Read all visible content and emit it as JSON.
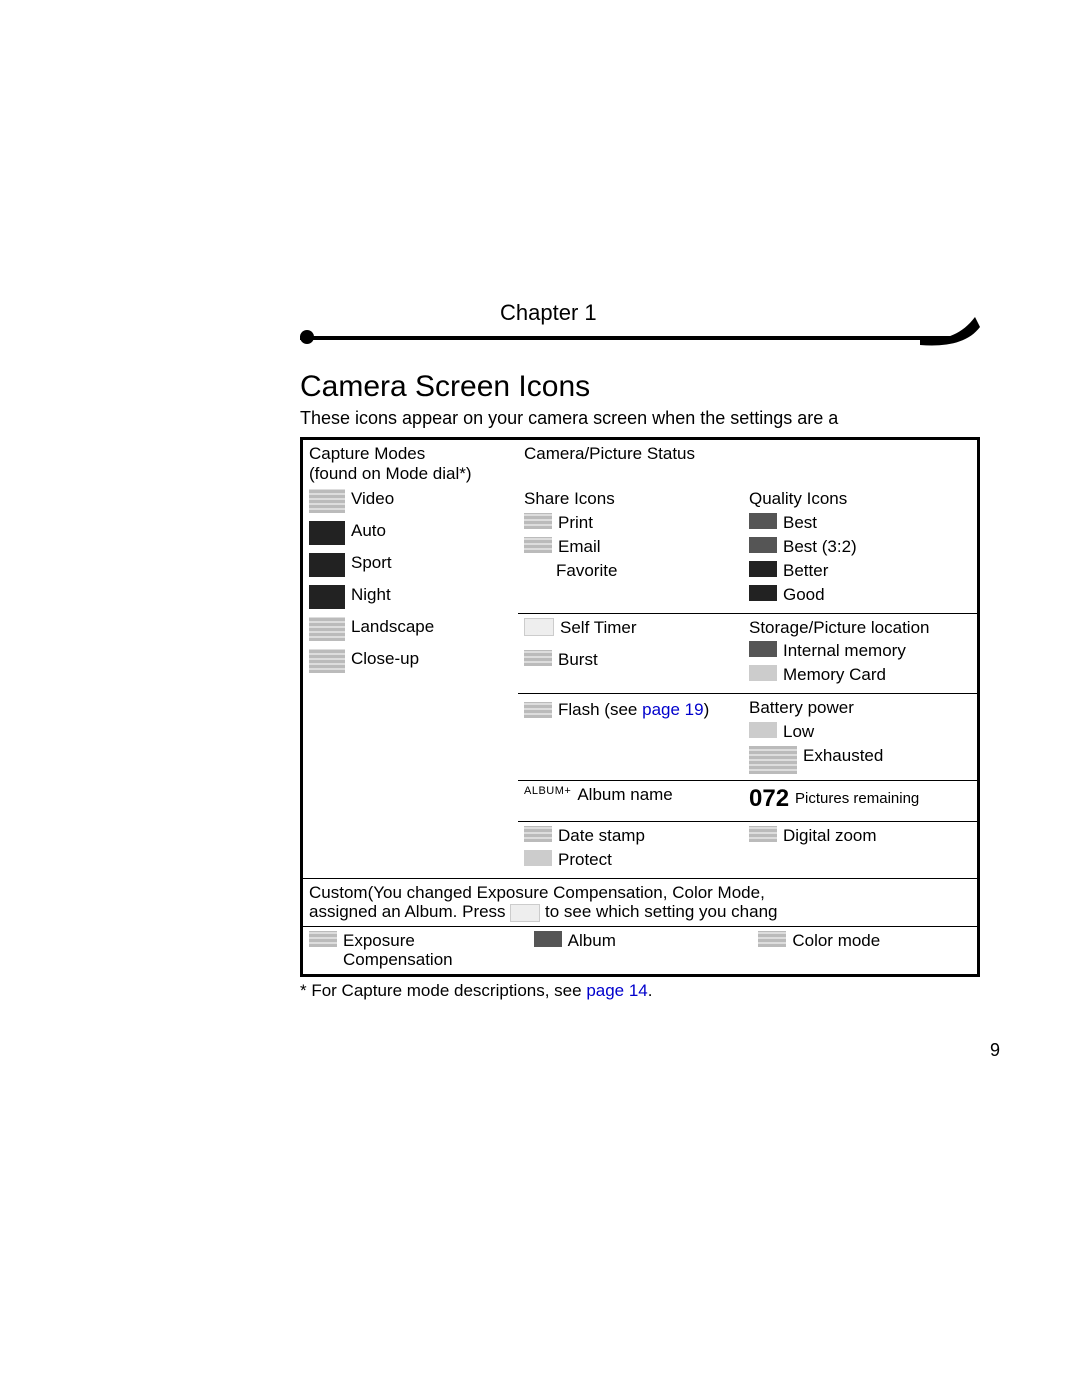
{
  "chapter_label": "Chapter 1",
  "section_title": "Camera Screen Icons",
  "subtitle": "These icons appear on your camera screen when the settings are a",
  "page_number": "9",
  "capture_modes": {
    "heading": "Capture Modes",
    "subheading": "(found on Mode dial*)",
    "items": [
      "Video",
      "Auto",
      "Sport",
      "Night",
      "Landscape",
      "Close-up"
    ]
  },
  "camera_status_heading": "Camera/Picture Status",
  "share_icons": {
    "heading": "Share Icons",
    "items": [
      "Print",
      "Email",
      "Favorite"
    ]
  },
  "quality_icons": {
    "heading": "Quality Icons",
    "items": [
      "Best",
      "Best (3:2)",
      "Better",
      "Good"
    ]
  },
  "storage": {
    "heading": "Storage/Picture location",
    "items": [
      "Internal memory",
      "Memory Card"
    ]
  },
  "misc": {
    "self_timer": "Self Timer",
    "burst": "Burst",
    "flash_label": "Flash (see",
    "flash_link": "page 19",
    "flash_close": ")",
    "album_plus": "ALBUM+",
    "album_name": "Album name",
    "date_stamp": "Date stamp",
    "protect": "Protect"
  },
  "battery": {
    "heading": "Battery power",
    "items": [
      "Low",
      "Exhausted"
    ]
  },
  "pictures_remaining": {
    "number": "072",
    "label": "Pictures remaining"
  },
  "digital_zoom": "Digital zoom",
  "custom_note": {
    "prefix": "Custom",
    "line1_rest": "(You changed Exposure Compensation, Color Mode,",
    "line2a": "assigned an Album. Press ",
    "line2b": " to see which setting you chang"
  },
  "bottom_row": {
    "exposure": "Exposure Compensation",
    "album": "Album",
    "color_mode": "Color mode"
  },
  "footnote": {
    "text": "* For Capture mode descriptions, see ",
    "link": "page 14"
  }
}
